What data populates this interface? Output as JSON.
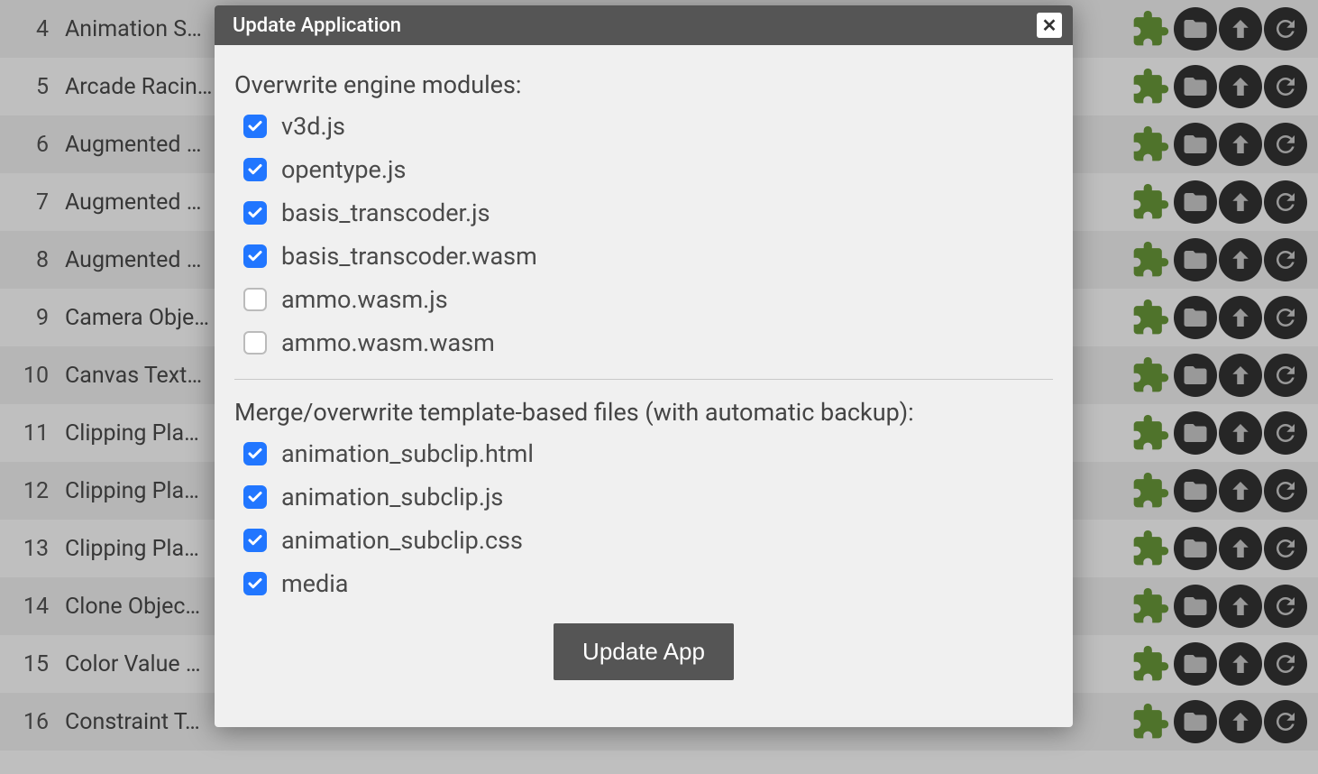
{
  "background_rows": [
    {
      "num": "4",
      "title": "Animation S…"
    },
    {
      "num": "5",
      "title": "Arcade Racin…"
    },
    {
      "num": "6",
      "title": "Augmented …"
    },
    {
      "num": "7",
      "title": "Augmented …"
    },
    {
      "num": "8",
      "title": "Augmented …"
    },
    {
      "num": "9",
      "title": "Camera Obje…"
    },
    {
      "num": "10",
      "title": "Canvas Text…"
    },
    {
      "num": "11",
      "title": "Clipping Pla…"
    },
    {
      "num": "12",
      "title": "Clipping Pla…"
    },
    {
      "num": "13",
      "title": "Clipping Pla…"
    },
    {
      "num": "14",
      "title": "Clone Objec…"
    },
    {
      "num": "15",
      "title": "Color Value …"
    },
    {
      "num": "16",
      "title": "Constraint T…"
    }
  ],
  "modal": {
    "title": "Update Application",
    "section1_title": "Overwrite engine modules:",
    "engine_modules": [
      {
        "label": "v3d.js",
        "checked": true
      },
      {
        "label": "opentype.js",
        "checked": true
      },
      {
        "label": "basis_transcoder.js",
        "checked": true
      },
      {
        "label": "basis_transcoder.wasm",
        "checked": true
      },
      {
        "label": "ammo.wasm.js",
        "checked": false
      },
      {
        "label": "ammo.wasm.wasm",
        "checked": false
      }
    ],
    "section2_title": "Merge/overwrite template-based files (with automatic backup):",
    "template_files": [
      {
        "label": "animation_subclip.html",
        "checked": true
      },
      {
        "label": "animation_subclip.js",
        "checked": true
      },
      {
        "label": "animation_subclip.css",
        "checked": true
      },
      {
        "label": "media",
        "checked": true
      }
    ],
    "update_button": "Update App"
  },
  "icons": {
    "puzzle": "puzzle-icon",
    "folder": "folder-icon",
    "upload": "upload-icon",
    "refresh": "refresh-icon"
  }
}
